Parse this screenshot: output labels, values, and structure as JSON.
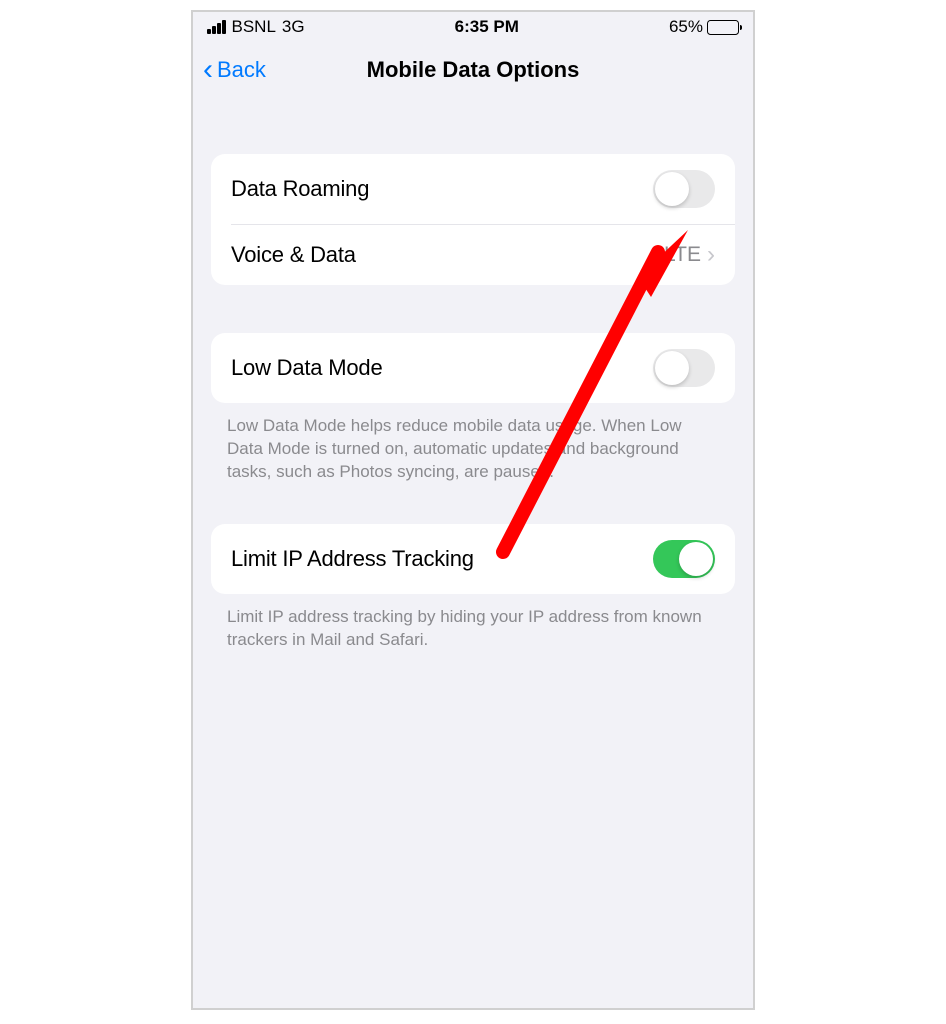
{
  "statusBar": {
    "carrier": "BSNL",
    "network": "3G",
    "time": "6:35 PM",
    "batteryPercent": "65%"
  },
  "nav": {
    "backLabel": "Back",
    "title": "Mobile Data Options"
  },
  "rows": {
    "dataRoaming": {
      "label": "Data Roaming",
      "on": false
    },
    "voiceData": {
      "label": "Voice & Data",
      "value": "LTE"
    },
    "lowDataMode": {
      "label": "Low Data Mode",
      "on": false
    },
    "limitIP": {
      "label": "Limit IP Address Tracking",
      "on": true
    }
  },
  "footers": {
    "lowData": "Low Data Mode helps reduce mobile data usage. When Low Data Mode is turned on, automatic updates and background tasks, such as Photos syncing, are paused.",
    "limitIP": "Limit IP address tracking by hiding your IP address from known trackers in Mail and Safari."
  },
  "annotation": {
    "arrowColor": "#ff0000"
  }
}
